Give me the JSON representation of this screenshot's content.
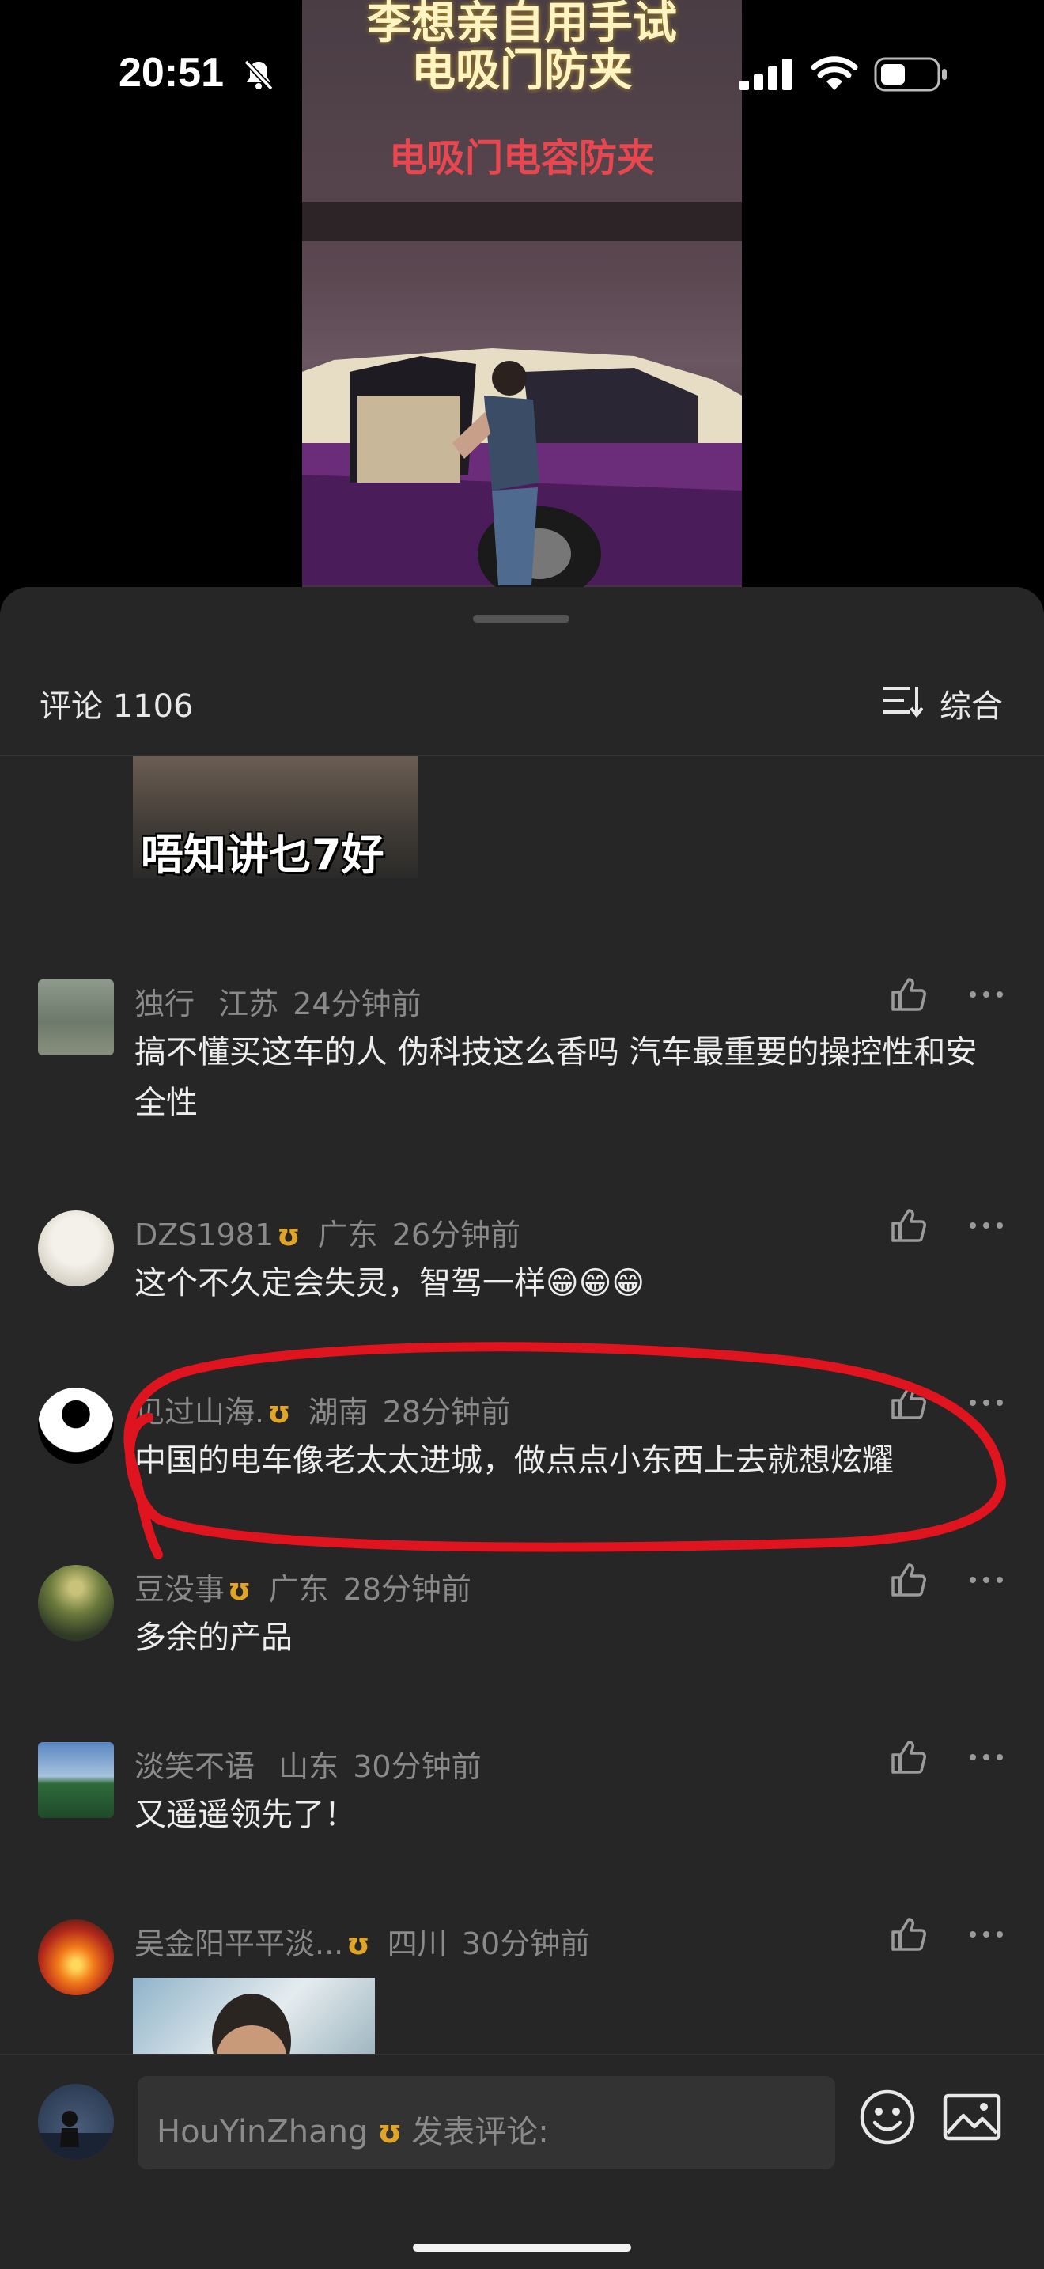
{
  "status_bar": {
    "time": "20:51"
  },
  "video": {
    "title_line1": "李想亲自用手试",
    "title_line2": "电吸门防夹",
    "subtitle": "电吸门电容防夹"
  },
  "panel": {
    "comments_label": "评论 1106",
    "sort_label": "综合"
  },
  "top_image": {
    "caption": "唔知讲乜7好"
  },
  "comments": [
    {
      "user": "独行",
      "region": "江苏",
      "time": "24分钟前",
      "vip": false,
      "text": "搞不懂买这车的人 伪科技这么香吗 汽车最重要的操控性和安全性"
    },
    {
      "user": "DZS1981",
      "region": "广东",
      "time": "26分钟前",
      "vip": true,
      "text": "这个不久定会失灵，智驾一样😁😁😁"
    },
    {
      "user": "见过山海.",
      "region": "湖南",
      "time": "28分钟前",
      "vip": true,
      "text": "中国的电车像老太太进城，做点点小东西上去就想炫耀"
    },
    {
      "user": "豆没事",
      "region": "广东",
      "time": "28分钟前",
      "vip": true,
      "text": "多余的产品"
    },
    {
      "user": "淡笑不语",
      "region": "山东",
      "time": "30分钟前",
      "vip": false,
      "text": "又遥遥领先了！"
    },
    {
      "user": "吴金阳平平淡...",
      "region": "四川",
      "time": "30分钟前",
      "vip": true,
      "text": ""
    }
  ],
  "vip_badge": "ʊ",
  "composer": {
    "username": "HouYinZhang",
    "placeholder": "发表评论:"
  },
  "colors": {
    "panel_bg": "#262626",
    "vip": "#e0a526",
    "annotation": "#e0141e"
  }
}
